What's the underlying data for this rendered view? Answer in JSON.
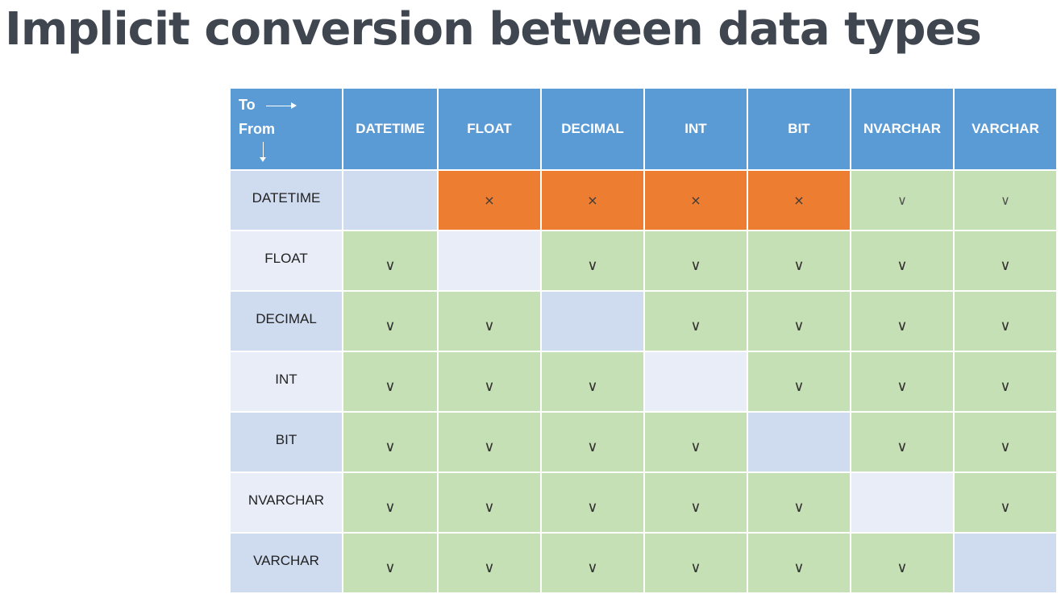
{
  "title": "Implicit conversion between data types",
  "corner": {
    "to": "To",
    "from": "From"
  },
  "columns": [
    "DATETIME",
    "FLOAT",
    "DECIMAL",
    "INT",
    "BIT",
    "NVARCHAR",
    "VARCHAR"
  ],
  "marks": {
    "yes": "∨",
    "no": "×"
  },
  "colors": {
    "header": "#5b9bd5",
    "allowed": "#c5e0b4",
    "not_allowed": "#ed7d31"
  },
  "rows": [
    {
      "label": "DATETIME",
      "cells": [
        "",
        "x",
        "x",
        "x",
        "x",
        "v",
        "v"
      ]
    },
    {
      "label": "FLOAT",
      "cells": [
        "v",
        "",
        "v",
        "v",
        "v",
        "v",
        "v"
      ]
    },
    {
      "label": "DECIMAL",
      "cells": [
        "v",
        "v",
        "",
        "v",
        "v",
        "v",
        "v"
      ]
    },
    {
      "label": "INT",
      "cells": [
        "v",
        "v",
        "v",
        "",
        "v",
        "v",
        "v"
      ]
    },
    {
      "label": "BIT",
      "cells": [
        "v",
        "v",
        "v",
        "v",
        "",
        "v",
        "v"
      ]
    },
    {
      "label": "NVARCHAR",
      "cells": [
        "v",
        "v",
        "v",
        "v",
        "v",
        "",
        "v"
      ]
    },
    {
      "label": "VARCHAR",
      "cells": [
        "v",
        "v",
        "v",
        "v",
        "v",
        "v",
        ""
      ]
    }
  ]
}
